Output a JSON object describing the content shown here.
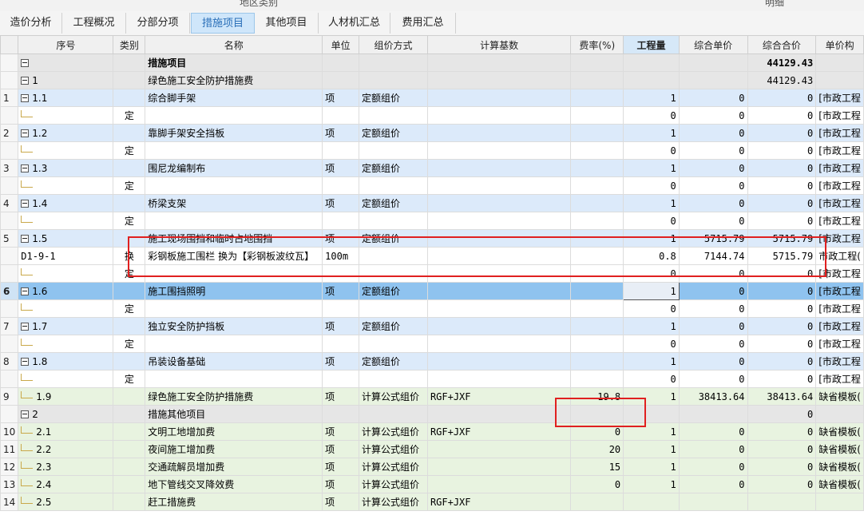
{
  "top_strip": {
    "left_text": "地区类别",
    "right_text": "明细"
  },
  "tabs": [
    {
      "label": "造价分析",
      "active": false
    },
    {
      "label": "工程概况",
      "active": false
    },
    {
      "label": "分部分项",
      "active": false
    },
    {
      "label": "措施项目",
      "active": true
    },
    {
      "label": "其他项目",
      "active": false
    },
    {
      "label": "人材机汇总",
      "active": false
    },
    {
      "label": "费用汇总",
      "active": false
    }
  ],
  "columns": [
    "",
    "序号",
    "类别",
    "名称",
    "单位",
    "组价方式",
    "计算基数",
    "费率(%)",
    "工程量",
    "综合单价",
    "综合合价",
    "单价构"
  ],
  "rows": [
    {
      "rn": "",
      "seq": "",
      "cat": "",
      "name": "措施项目",
      "unit": "",
      "method": "",
      "base": "",
      "rate": "",
      "qty": "",
      "price": "",
      "total": "44129.43",
      "tpl": ""
    },
    {
      "rn": "",
      "seq": "1",
      "cat": "",
      "name": "绿色施工安全防护措施费",
      "unit": "",
      "method": "",
      "base": "",
      "rate": "",
      "qty": "",
      "price": "",
      "total": "44129.43",
      "tpl": ""
    },
    {
      "rn": "1",
      "seq": "1.1",
      "cat": "",
      "name": "综合脚手架",
      "unit": "项",
      "method": "定额组价",
      "base": "",
      "rate": "",
      "qty": "1",
      "price": "0",
      "total": "0",
      "tpl": "[市政工程"
    },
    {
      "rn": "",
      "seq": "",
      "cat": "定",
      "name": "",
      "unit": "",
      "method": "",
      "base": "",
      "rate": "",
      "qty": "0",
      "price": "0",
      "total": "0",
      "tpl": "[市政工程"
    },
    {
      "rn": "2",
      "seq": "1.2",
      "cat": "",
      "name": "靠脚手架安全挡板",
      "unit": "项",
      "method": "定额组价",
      "base": "",
      "rate": "",
      "qty": "1",
      "price": "0",
      "total": "0",
      "tpl": "[市政工程"
    },
    {
      "rn": "",
      "seq": "",
      "cat": "定",
      "name": "",
      "unit": "",
      "method": "",
      "base": "",
      "rate": "",
      "qty": "0",
      "price": "0",
      "total": "0",
      "tpl": "[市政工程"
    },
    {
      "rn": "3",
      "seq": "1.3",
      "cat": "",
      "name": "围尼龙编制布",
      "unit": "项",
      "method": "定额组价",
      "base": "",
      "rate": "",
      "qty": "1",
      "price": "0",
      "total": "0",
      "tpl": "[市政工程"
    },
    {
      "rn": "",
      "seq": "",
      "cat": "定",
      "name": "",
      "unit": "",
      "method": "",
      "base": "",
      "rate": "",
      "qty": "0",
      "price": "0",
      "total": "0",
      "tpl": "[市政工程"
    },
    {
      "rn": "4",
      "seq": "1.4",
      "cat": "",
      "name": "桥梁支架",
      "unit": "项",
      "method": "定额组价",
      "base": "",
      "rate": "",
      "qty": "1",
      "price": "0",
      "total": "0",
      "tpl": "[市政工程"
    },
    {
      "rn": "",
      "seq": "",
      "cat": "定",
      "name": "",
      "unit": "",
      "method": "",
      "base": "",
      "rate": "",
      "qty": "0",
      "price": "0",
      "total": "0",
      "tpl": "[市政工程"
    },
    {
      "rn": "5",
      "seq": "1.5",
      "cat": "",
      "name": "施工现场围挡和临时占地围挡",
      "unit": "项",
      "method": "定额组价",
      "base": "",
      "rate": "",
      "qty": "1",
      "price": "5715.79",
      "total": "5715.79",
      "tpl": "[市政工程"
    },
    {
      "rn": "",
      "seq": "D1-9-1",
      "cat": "换",
      "name": "彩钢板施工围栏  换为【彩钢板波纹瓦】",
      "unit": "100m",
      "method": "",
      "base": "",
      "rate": "",
      "qty": "0.8",
      "price": "7144.74",
      "total": "5715.79",
      "tpl": "市政工程("
    },
    {
      "rn": "",
      "seq": "",
      "cat": "定",
      "name": "",
      "unit": "",
      "method": "",
      "base": "",
      "rate": "",
      "qty": "0",
      "price": "0",
      "total": "0",
      "tpl": "[市政工程"
    },
    {
      "rn": "6",
      "seq": "1.6",
      "cat": "",
      "name": "施工围挡照明",
      "unit": "项",
      "method": "定额组价",
      "base": "",
      "rate": "",
      "qty": "1",
      "price": "0",
      "total": "0",
      "tpl": "[市政工程"
    },
    {
      "rn": "",
      "seq": "",
      "cat": "定",
      "name": "",
      "unit": "",
      "method": "",
      "base": "",
      "rate": "",
      "qty": "0",
      "price": "0",
      "total": "0",
      "tpl": "[市政工程"
    },
    {
      "rn": "7",
      "seq": "1.7",
      "cat": "",
      "name": "独立安全防护挡板",
      "unit": "项",
      "method": "定额组价",
      "base": "",
      "rate": "",
      "qty": "1",
      "price": "0",
      "total": "0",
      "tpl": "[市政工程"
    },
    {
      "rn": "",
      "seq": "",
      "cat": "定",
      "name": "",
      "unit": "",
      "method": "",
      "base": "",
      "rate": "",
      "qty": "0",
      "price": "0",
      "total": "0",
      "tpl": "[市政工程"
    },
    {
      "rn": "8",
      "seq": "1.8",
      "cat": "",
      "name": "吊装设备基础",
      "unit": "项",
      "method": "定额组价",
      "base": "",
      "rate": "",
      "qty": "1",
      "price": "0",
      "total": "0",
      "tpl": "[市政工程"
    },
    {
      "rn": "",
      "seq": "",
      "cat": "定",
      "name": "",
      "unit": "",
      "method": "",
      "base": "",
      "rate": "",
      "qty": "0",
      "price": "0",
      "total": "0",
      "tpl": "[市政工程"
    },
    {
      "rn": "9",
      "seq": "1.9",
      "cat": "",
      "name": "绿色施工安全防护措施费",
      "unit": "项",
      "method": "计算公式组价",
      "base": "RGF+JXF",
      "rate": "19.8",
      "qty": "1",
      "price": "38413.64",
      "total": "38413.64",
      "tpl": "缺省模板("
    },
    {
      "rn": "",
      "seq": "2",
      "cat": "",
      "name": "措施其他项目",
      "unit": "",
      "method": "",
      "base": "",
      "rate": "",
      "qty": "",
      "price": "",
      "total": "0",
      "tpl": ""
    },
    {
      "rn": "10",
      "seq": "2.1",
      "cat": "",
      "name": "文明工地增加费",
      "unit": "项",
      "method": "计算公式组价",
      "base": "RGF+JXF",
      "rate": "0",
      "qty": "1",
      "price": "0",
      "total": "0",
      "tpl": "缺省模板("
    },
    {
      "rn": "11",
      "seq": "2.2",
      "cat": "",
      "name": "夜间施工增加费",
      "unit": "项",
      "method": "计算公式组价",
      "base": "",
      "rate": "20",
      "qty": "1",
      "price": "0",
      "total": "0",
      "tpl": "缺省模板("
    },
    {
      "rn": "12",
      "seq": "2.3",
      "cat": "",
      "name": "交通疏解员增加费",
      "unit": "项",
      "method": "计算公式组价",
      "base": "",
      "rate": "15",
      "qty": "1",
      "price": "0",
      "total": "0",
      "tpl": "缺省模板("
    },
    {
      "rn": "13",
      "seq": "2.4",
      "cat": "",
      "name": "地下管线交叉降效费",
      "unit": "项",
      "method": "计算公式组价",
      "base": "",
      "rate": "0",
      "qty": "1",
      "price": "0",
      "total": "0",
      "tpl": "缺省模板("
    },
    {
      "rn": "14",
      "seq": "2.5",
      "cat": "",
      "name": "赶工措施费",
      "unit": "项",
      "method": "计算公式组价",
      "base": "RGF+JXF",
      "rate": "",
      "qty": "",
      "price": "",
      "total": "",
      "tpl": ""
    }
  ]
}
